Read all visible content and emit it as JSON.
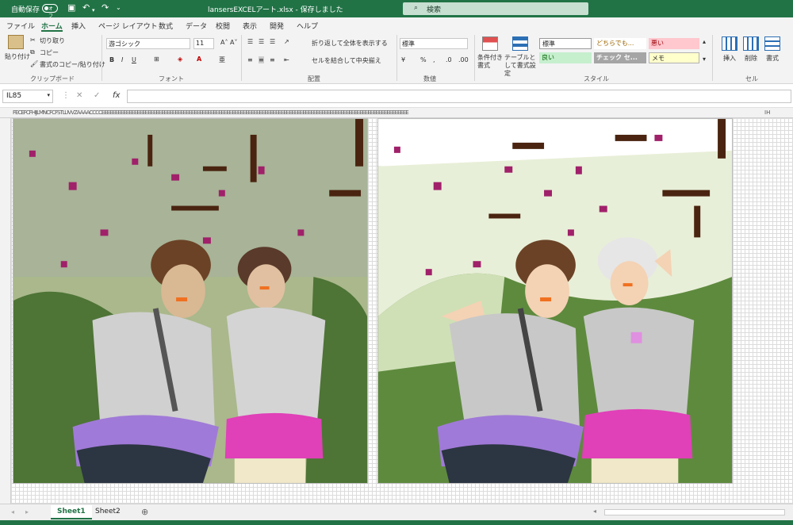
{
  "titlebar": {
    "autosave_label": "自動保存",
    "autosave_state": "オフ",
    "filename": "lansersEXCELアート.xlsx - 保存しました",
    "search_placeholder": "検索"
  },
  "ribbon_tabs": [
    "ファイル",
    "ホーム",
    "挿入",
    "ページ レイアウト",
    "数式",
    "データ",
    "校閲",
    "表示",
    "開発",
    "ヘルプ"
  ],
  "active_tab": "ホーム",
  "clipboard": {
    "paste": "貼り付け",
    "cut": "切り取り",
    "copy": "コピー",
    "format_painter": "書式のコピー/貼り付け",
    "group": "クリップボード"
  },
  "font": {
    "name": "游ゴシック",
    "size": "11",
    "group": "フォント"
  },
  "alignment": {
    "wrap": "折り返して全体を表示する",
    "merge": "セルを結合して中央揃え",
    "group": "配置"
  },
  "number": {
    "format": "標準",
    "group": "数値"
  },
  "styles": {
    "conditional": "条件付き書式",
    "table": "テーブルとして書式設定",
    "cells": [
      "標準",
      "どちらでも...",
      "悪い",
      "良い",
      "チェック セ...",
      "メモ"
    ],
    "group": "スタイル"
  },
  "cells_group": {
    "insert": "挿入",
    "delete": "削除",
    "format": "書式",
    "group": "セル"
  },
  "formula_bar": {
    "name_box": "IL85",
    "fx": "fx",
    "value": ""
  },
  "column_header_text": "FECEFCFHIJLMNCFCFSTLUVVZAAAACCCCEEEEEEEEEEEEEEEEEEEEEEEEEEEEEEEEEEEEEEEEEEEEEEEEEEEEEEEEEEEEEEEEEEEEEEEEEEEEEEEEEEEEEEEEEEEEEEEEEEEEEEEEEEEEEEEEE",
  "column_header_last": "IH",
  "sheets": [
    "Sheet1",
    "Sheet2"
  ],
  "active_sheet": "Sheet1",
  "colors": {
    "excel_green": "#217346",
    "shirt_gray": "#c8c8c8",
    "skirt_purple": "#a07ad8",
    "skirt_pink": "#e040b8",
    "flower_magenta": "#a0206a",
    "branch_brown": "#4a2410",
    "foliage_dark": "#3e6a2a",
    "foliage_light": "#b8d49a"
  }
}
